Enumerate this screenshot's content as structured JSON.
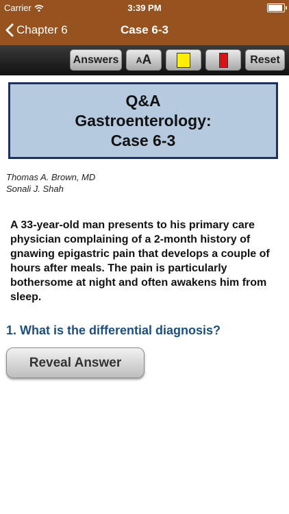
{
  "status_bar": {
    "carrier": "Carrier",
    "time": "3:39 PM"
  },
  "nav": {
    "back_label": "Chapter 6",
    "title": "Case 6-3"
  },
  "toolbar": {
    "answers_label": "Answers",
    "font_small": "A",
    "font_big": "A",
    "highlight_yellow_color": "#ffee00",
    "highlight_red_color": "#e01010",
    "reset_label": "Reset"
  },
  "title_box": {
    "line1": "Q&A",
    "line2": "Gastroenterology:",
    "line3": "Case 6-3"
  },
  "authors": [
    "Thomas A. Brown, MD",
    "Sonali J. Shah"
  ],
  "case_text": "A 33-year-old man presents to his primary care physician complaining of a 2-month history of gnawing epigastric pain that develops a couple of hours after meals. The pain is particularly bothersome at night and often awakens him from sleep.",
  "question": "1. What is the differential diagnosis?",
  "reveal_button_label": "Reveal Answer",
  "colors": {
    "brand_brown": "#96521f",
    "title_box_bg": "#b5c9df",
    "title_box_border": "#1d2f5c",
    "question_blue": "#1b4f7f"
  }
}
